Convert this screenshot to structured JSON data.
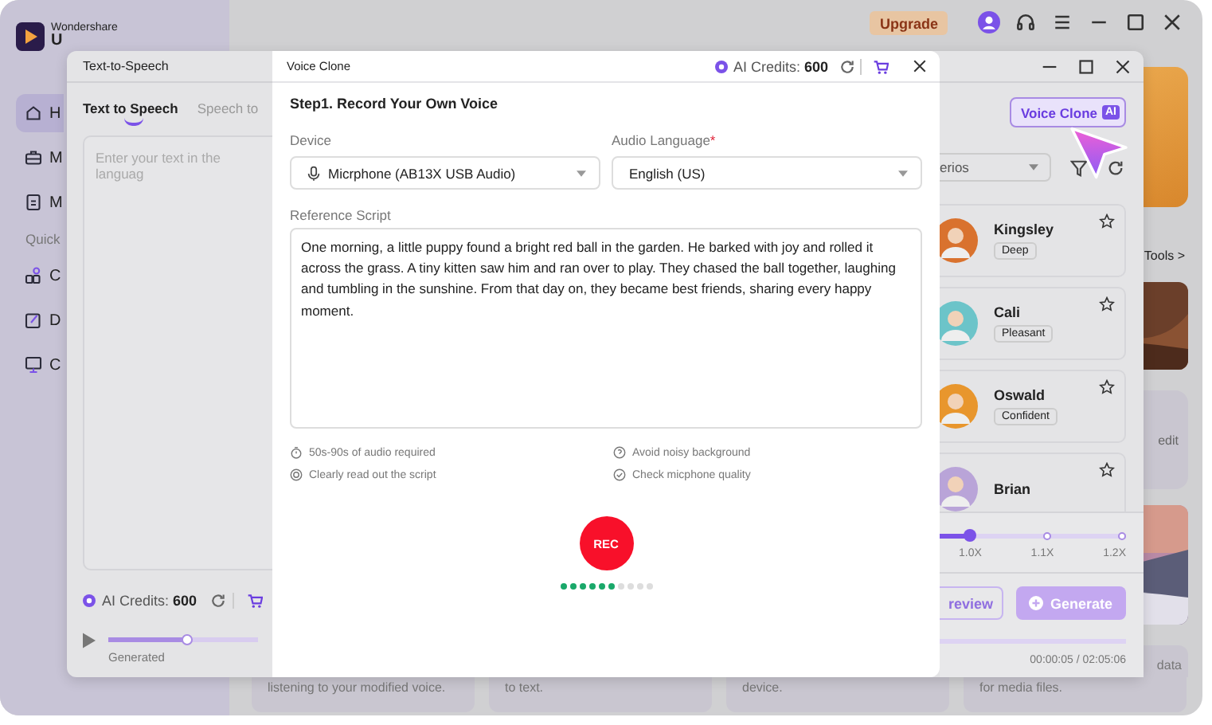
{
  "app": {
    "brand": "Wondershare",
    "product": "U",
    "upgrade": "Upgrade",
    "sidebar": [
      {
        "kind": "item",
        "label": "H",
        "selected": true
      },
      {
        "kind": "item",
        "label": "M",
        "selected": false
      },
      {
        "kind": "item",
        "label": "M",
        "selected": false
      },
      {
        "kind": "section",
        "label": "Quick"
      },
      {
        "kind": "item",
        "label": "C",
        "selected": false
      },
      {
        "kind": "item",
        "label": "D",
        "selected": false
      },
      {
        "kind": "item",
        "label": "C",
        "selected": false
      }
    ],
    "tools_link": "Tools >",
    "card_text": "edit",
    "bottom_cards": [
      {
        "text": "listening to your modified voice."
      },
      {
        "text": "to text."
      },
      {
        "text": "device."
      },
      {
        "text": "for media files."
      }
    ],
    "card_tail": "data"
  },
  "tts": {
    "title": "Text-to-Speech",
    "tabs": [
      {
        "label": "Text to Speech",
        "selected": true
      },
      {
        "label": "Speech to",
        "selected": false
      }
    ],
    "placeholder": "Enter your text in the languag",
    "credits": "AI Credits: **600**",
    "playback": {
      "level": 0.53,
      "label": "Generated"
    },
    "voice_clone_button": "Voice Clone",
    "ai_badge": "AI",
    "filter_value": "erios",
    "voices": [
      {
        "name": "Kingsley",
        "tag": "Deep",
        "color": "#d9722e"
      },
      {
        "name": "Cali",
        "tag": "Pleasant",
        "color": "#6cc4c9"
      },
      {
        "name": "Oswald",
        "tag": "Confident",
        "color": "#e8962d"
      },
      {
        "name": "Brian",
        "color": "#b9a4d8"
      }
    ],
    "speed": {
      "level": 0.16,
      "ticks": [
        "1.0X",
        "1.1X",
        "1.2X"
      ]
    },
    "preview_button": "review",
    "generate_button": "Generate",
    "progress": {
      "level": 0
    },
    "time": "00:00:05 / 02:05:06"
  },
  "dialog": {
    "title": "Voice Clone",
    "credits": "AI Credits: **600**",
    "step": "Step1. Record Your Own Voice",
    "device": {
      "label": "Device",
      "value": "Micrphone (AB13X USB Audio)"
    },
    "language": {
      "label": "Audio Language",
      "required_mark": "*",
      "value": "English (US)"
    },
    "script_label": "Reference Script",
    "script": "One morning, a little puppy found a bright red ball in the garden. He barked with joy and rolled it across the grass. A tiny kitten saw him and ran over to play. They chased the ball together, laughing and tumbling in the sunshine. From that day on, they became best friends, sharing every happy moment.",
    "tips": [
      {
        "text": "50s-90s of audio required"
      },
      {
        "text": "Avoid noisy background"
      },
      {
        "text": "Clearly read out the script"
      },
      {
        "text": "Check micphone quality"
      }
    ],
    "record_button": "REC",
    "recording": {
      "level": 0.6
    }
  }
}
